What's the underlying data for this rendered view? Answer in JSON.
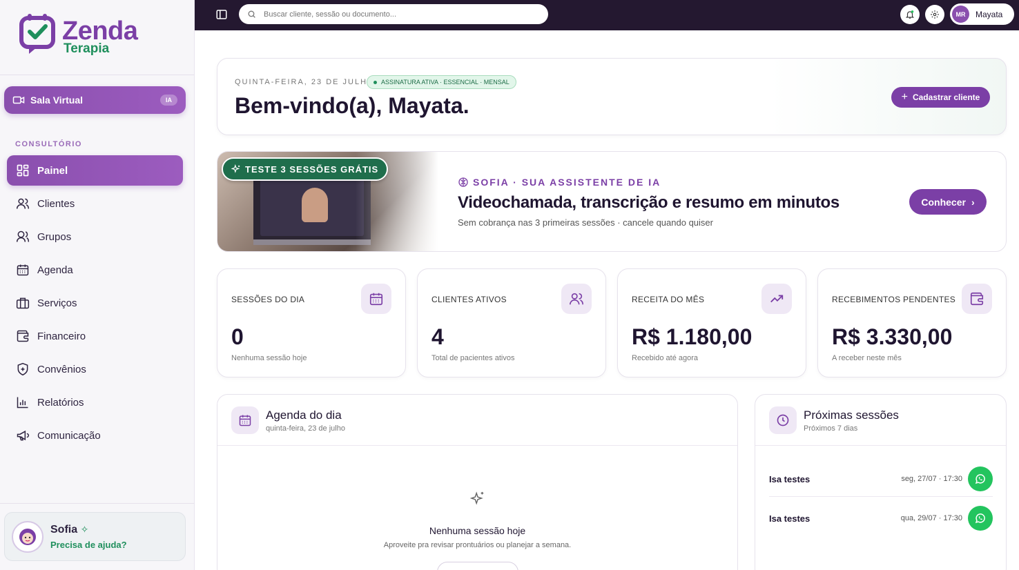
{
  "brand": {
    "name": "Zenda",
    "tagline": "Terapia"
  },
  "sidebar": {
    "sala_virtual": {
      "label": "Sala Virtual",
      "badge": "IA"
    },
    "section_label": "CONSULTÓRIO",
    "items": [
      {
        "label": "Painel",
        "icon": "grid-icon",
        "active": true
      },
      {
        "label": "Clientes",
        "icon": "users-icon"
      },
      {
        "label": "Grupos",
        "icon": "group-icon"
      },
      {
        "label": "Agenda",
        "icon": "calendar-icon"
      },
      {
        "label": "Serviços",
        "icon": "briefcase-icon"
      },
      {
        "label": "Financeiro",
        "icon": "wallet-icon"
      },
      {
        "label": "Convênios",
        "icon": "shield-plus-icon"
      },
      {
        "label": "Relatórios",
        "icon": "bar-chart-icon"
      },
      {
        "label": "Comunicação",
        "icon": "megaphone-icon"
      }
    ],
    "assistant": {
      "name": "Sofia",
      "help": "Precisa de ajuda?"
    }
  },
  "topbar": {
    "search_placeholder": "Buscar cliente, sessão ou documento...",
    "user": {
      "initials": "MR",
      "name": "Mayata"
    }
  },
  "welcome": {
    "date": "QUINTA-FEIRA, 23 DE JULHO",
    "subscription": "ASSINATURA ATIVA · ESSENCIAL · MENSAL",
    "title": "Bem-vindo(a), Mayata.",
    "cta": "Cadastrar cliente"
  },
  "banner": {
    "tag": "TESTE 3 SESSÕES GRÁTIS",
    "kicker": "SOFIA · SUA ASSISTENTE DE IA",
    "title": "Videochamada, transcrição e resumo em minutos",
    "subtitle": "Sem cobrança nas 3 primeiras sessões · cancele quando quiser",
    "cta": "Conhecer"
  },
  "stats": [
    {
      "label": "SESSÕES DO DIA",
      "value": "0",
      "note": "Nenhuma sessão hoje",
      "icon": "calendar-icon"
    },
    {
      "label": "CLIENTES ATIVOS",
      "value": "4",
      "note": "Total de pacientes ativos",
      "icon": "users-icon"
    },
    {
      "label": "RECEITA DO MÊS",
      "value": "R$ 1.180,00",
      "note": "Recebido até agora",
      "icon": "trending-up-icon"
    },
    {
      "label": "RECEBIMENTOS PENDENTES",
      "value": "R$ 3.330,00",
      "note": "A receber neste mês",
      "icon": "wallet-icon"
    }
  ],
  "agenda": {
    "title": "Agenda do dia",
    "subtitle": "quinta-feira, 23 de julho",
    "empty_title": "Nenhuma sessão hoje",
    "empty_sub": "Aproveite pra revisar prontuários ou planejar a semana."
  },
  "upcoming": {
    "title": "Próximas sessões",
    "subtitle": "Próximos 7 dias",
    "sessions": [
      {
        "name": "Isa testes",
        "date": "seg, 27/07 · 17:30"
      },
      {
        "name": "Isa testes",
        "date": "qua, 29/07 · 17:30"
      }
    ]
  },
  "colors": {
    "brand_purple": "#7b3fa6",
    "brand_green": "#1f8f5c",
    "topbar": "#241830",
    "whatsapp": "#23c45e"
  }
}
